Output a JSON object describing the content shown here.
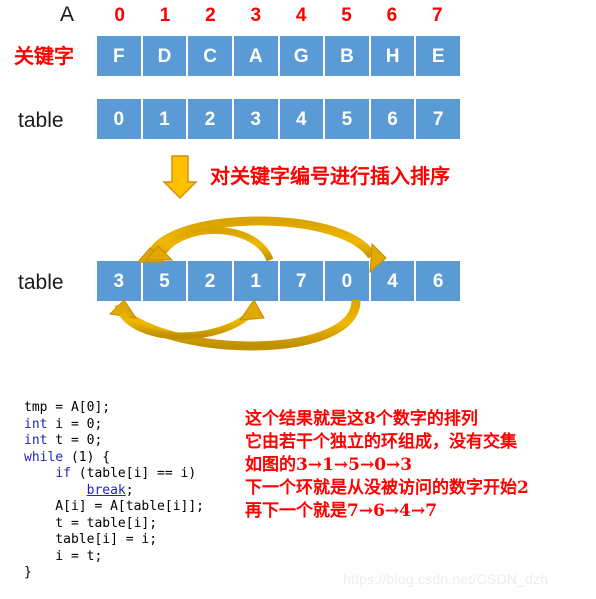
{
  "labels": {
    "array_a": "A",
    "keyword": "关键字",
    "table_1": "table",
    "table_2": "table"
  },
  "colors": {
    "cell_blue": "#5B9BD5",
    "index_red": "#ff0000",
    "arrow_gold": "#E8A500",
    "arrow_gold_dark": "#BF8F00",
    "code_keyword_blue": "#2222cc",
    "watermark_gray": "#ececec"
  },
  "index_header": [
    "0",
    "1",
    "2",
    "3",
    "4",
    "5",
    "6",
    "7"
  ],
  "keyword_row": [
    "F",
    "D",
    "C",
    "A",
    "G",
    "B",
    "H",
    "E"
  ],
  "table_row_initial": [
    "0",
    "1",
    "2",
    "3",
    "4",
    "5",
    "6",
    "7"
  ],
  "table_row_sorted": [
    "3",
    "5",
    "2",
    "1",
    "7",
    "0",
    "4",
    "6"
  ],
  "middle_note": "对关键字编号进行插入排序",
  "code_lines": [
    {
      "segments": [
        {
          "t": "tmp = A[0];",
          "c": "plain"
        }
      ]
    },
    {
      "segments": [
        {
          "t": "int",
          "c": "kw"
        },
        {
          "t": " i = 0;",
          "c": "plain"
        }
      ]
    },
    {
      "segments": [
        {
          "t": "int",
          "c": "kw"
        },
        {
          "t": " t = 0;",
          "c": "plain"
        }
      ]
    },
    {
      "segments": [
        {
          "t": "while",
          "c": "kw"
        },
        {
          "t": " (1) {",
          "c": "plain"
        }
      ]
    },
    {
      "segments": [
        {
          "t": "    ",
          "c": "plain"
        },
        {
          "t": "if",
          "c": "kw"
        },
        {
          "t": " (table[i] == i)",
          "c": "plain"
        }
      ]
    },
    {
      "segments": [
        {
          "t": "        ",
          "c": "plain"
        },
        {
          "t": "break",
          "c": "brk"
        },
        {
          "t": ";",
          "c": "plain"
        }
      ]
    },
    {
      "segments": [
        {
          "t": "    A[i] = A[table[i]];",
          "c": "plain"
        }
      ]
    },
    {
      "segments": [
        {
          "t": "    t = table[i];",
          "c": "plain"
        }
      ]
    },
    {
      "segments": [
        {
          "t": "    table[i] = i;",
          "c": "plain"
        }
      ]
    },
    {
      "segments": [
        {
          "t": "    i = t;",
          "c": "plain"
        }
      ]
    },
    {
      "segments": [
        {
          "t": "}",
          "c": "plain"
        }
      ]
    }
  ],
  "explanation_lines": [
    "这个结果就是这8个数字的排列",
    "它由若干个独立的环组成，没有交集",
    "如图的3→1→5→0→3",
    "下一个环就是从没被访问的数字开始2",
    "再下一个就是7→6→4→7"
  ],
  "cycles": {
    "cycle_1": "3→1→5→0→3",
    "cycle_2": "2",
    "cycle_3": "7→6→4→7"
  },
  "watermark": "https://blog.csdn.net/CSDN_dzh"
}
